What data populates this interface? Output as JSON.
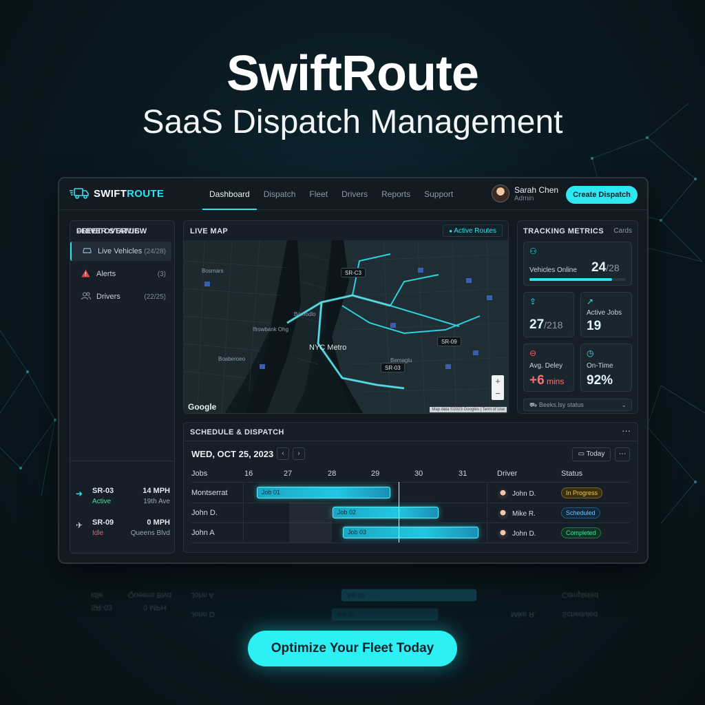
{
  "hero": {
    "title": "SwiftRoute",
    "subtitle": "SaaS Dispatch Management"
  },
  "brand": {
    "logo_main": "SWIFT",
    "logo_accent": "ROUTE",
    "accent_color": "#2fe3f0"
  },
  "nav": {
    "items": [
      {
        "label": "Dashboard",
        "active": true
      },
      {
        "label": "Dispatch"
      },
      {
        "label": "Fleet"
      },
      {
        "label": "Drivers"
      },
      {
        "label": "Reports"
      },
      {
        "label": "Support"
      }
    ]
  },
  "user": {
    "name": "Sarah Chen",
    "role": "Admin"
  },
  "create_button": "Create Dispatch",
  "fleet_overview": {
    "title": "FLEET OVERVIEW",
    "items": [
      {
        "icon": "car-icon",
        "label": "Live Vehicles",
        "count": "(24/28)"
      },
      {
        "icon": "alert-icon",
        "label": "Alerts",
        "count": "(3)"
      },
      {
        "icon": "users-icon",
        "label": "Drivers",
        "count": "(22/25)"
      }
    ]
  },
  "driver_status": {
    "title": "DRIVER STATUS",
    "rows": [
      {
        "id": "SR-03",
        "state": "Active",
        "speed": "14 MPH",
        "location": "19th Ave",
        "state_color": "#46e098"
      },
      {
        "id": "SR-09",
        "state": "Idle",
        "speed": "0 MPH",
        "location": "Queens Blvd",
        "state_color": "#ff5b5b"
      }
    ]
  },
  "live_map": {
    "title": "LIVE MAP",
    "chip": "Active Routes",
    "city": "NYC Metro",
    "tags": [
      "SR-C3",
      "SR-09",
      "SR-03"
    ],
    "labels": [
      "Bosmars",
      "Ifrowbank Ohg",
      "Bomodlo",
      "Boaberoeo",
      "Bemaglu"
    ],
    "google": "Google",
    "attribution": "Map data ©2023 Googles | Term of Use",
    "zoom_in": "+",
    "zoom_out": "−"
  },
  "metrics": {
    "title": "TRACKING METRICS",
    "view": "Cards",
    "vehicles_online": {
      "label": "Vehicles Online",
      "value": "24",
      "total": "/28",
      "fraction": 0.857
    },
    "trips": {
      "value": "27",
      "total": "/218"
    },
    "active_jobs": {
      "label": "Active Jobs",
      "value": "19"
    },
    "avg_delay": {
      "label": "Avg. Deley",
      "value": "+6",
      "unit": " mins"
    },
    "on_time": {
      "label": "On-Time",
      "value": "92%"
    },
    "status_select": "Beeks.lsy status"
  },
  "schedule": {
    "title": "SCHEDULE & DISPATCH",
    "date": "WED, OCT 25, 2023",
    "today": "Today",
    "columns": {
      "jobs": "Jobs",
      "driver": "Driver",
      "status": "Status"
    },
    "days": [
      "16",
      "27",
      "28",
      "29",
      "30",
      "31"
    ],
    "rows": [
      {
        "name": "Montserrat",
        "job": "Job 01",
        "driver": "John D.",
        "status": "In Progress"
      },
      {
        "name": "John D.",
        "job": "Job 02",
        "driver": "Mike R.",
        "status": "Scheduled"
      },
      {
        "name": "John A",
        "job": "Job 03",
        "driver": "John D.",
        "status": "Completed"
      }
    ]
  },
  "reflection": {
    "a": "Idle",
    "b": "Queens Blvd",
    "c": "SR-03",
    "d": "0 MPH",
    "e": "John A",
    "f": "Job 02",
    "g": "John D",
    "h": "Job 03",
    "i": "Mike R.",
    "j": "Completed",
    "k": "Scheduled"
  },
  "cta": "Optimize Your Fleet Today"
}
